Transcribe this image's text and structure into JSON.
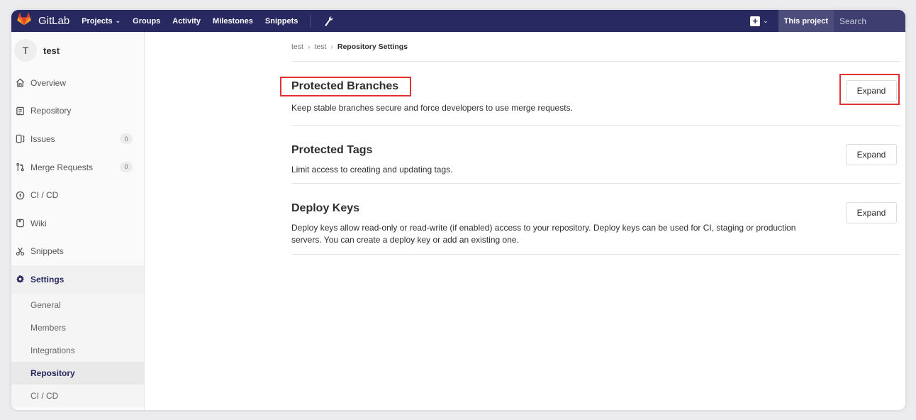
{
  "navbar": {
    "brand": "GitLab",
    "links": [
      {
        "label": "Projects",
        "has_chevron": true
      },
      {
        "label": "Groups"
      },
      {
        "label": "Activity"
      },
      {
        "label": "Milestones"
      },
      {
        "label": "Snippets"
      }
    ],
    "scope_label": "This project",
    "search_placeholder": "Search",
    "colors": {
      "bar": "#292961",
      "scope_bg": "#4d4d7c"
    }
  },
  "sidebar": {
    "avatar_letter": "T",
    "project_name": "test",
    "items": [
      {
        "label": "Overview",
        "icon": "home-icon"
      },
      {
        "label": "Repository",
        "icon": "doc-icon"
      },
      {
        "label": "Issues",
        "icon": "issues-icon",
        "badge": "0"
      },
      {
        "label": "Merge Requests",
        "icon": "merge-request-icon",
        "badge": "0"
      },
      {
        "label": "CI / CD",
        "icon": "rocket-icon"
      },
      {
        "label": "Wiki",
        "icon": "book-icon"
      },
      {
        "label": "Snippets",
        "icon": "scissors-icon"
      }
    ],
    "settings": {
      "label": "Settings",
      "icon": "gear-icon",
      "sub_items": [
        {
          "label": "General"
        },
        {
          "label": "Members"
        },
        {
          "label": "Integrations"
        },
        {
          "label": "Repository",
          "active": true
        },
        {
          "label": "CI / CD"
        }
      ]
    }
  },
  "breadcrumb": {
    "items": [
      "test",
      "test"
    ],
    "current": "Repository Settings"
  },
  "sections": [
    {
      "title": "Protected Branches",
      "description": "Keep stable branches secure and force developers to use merge requests.",
      "button": "Expand",
      "highlighted": true
    },
    {
      "title": "Protected Tags",
      "description": "Limit access to creating and updating tags.",
      "button": "Expand"
    },
    {
      "title": "Deploy Keys",
      "description": "Deploy keys allow read-only or read-write (if enabled) access to your repository. Deploy keys can be used for CI, staging or production servers. You can create a deploy key or add an existing one.",
      "button": "Expand"
    }
  ],
  "highlight_color": "#e23131"
}
